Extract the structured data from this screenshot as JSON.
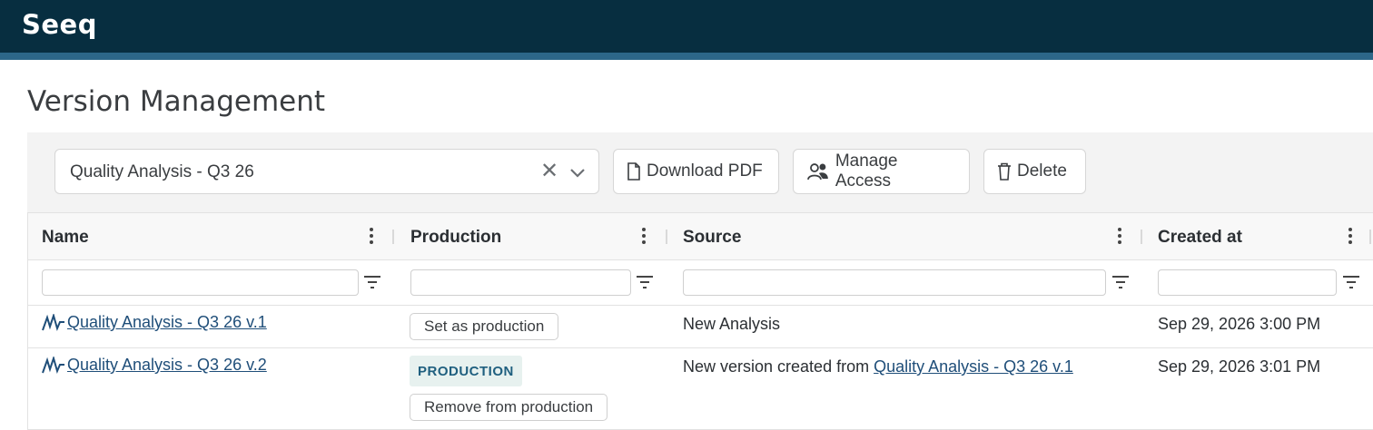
{
  "app": {
    "logo": "Seeq"
  },
  "page": {
    "title": "Version Management"
  },
  "toolbar": {
    "selected_analysis": "Quality Analysis - Q3 26",
    "download_pdf_label": "Download PDF",
    "manage_access_label": "Manage Access",
    "delete_label": "Delete"
  },
  "table": {
    "columns": [
      "Name",
      "Production",
      "Source",
      "Created at"
    ],
    "rows": [
      {
        "name": "Quality Analysis - Q3 26 v.1",
        "production_action": "Set as production",
        "source": "New Analysis",
        "created_at": "Sep 29, 2026 3:00 PM"
      },
      {
        "name": "Quality Analysis - Q3 26 v.2",
        "production_badge": "PRODUCTION",
        "production_action": "Remove from production",
        "source_prefix": "New version created from ",
        "source_link": "Quality Analysis - Q3 26 v.1",
        "created_at": "Sep 29, 2026 3:01 PM"
      }
    ]
  },
  "colors": {
    "header_bg": "#072e40",
    "header_accent": "#2c6789",
    "link": "#1f4e79",
    "badge_bg": "#e7f1ef",
    "badge_text": "#1f5f7f"
  }
}
